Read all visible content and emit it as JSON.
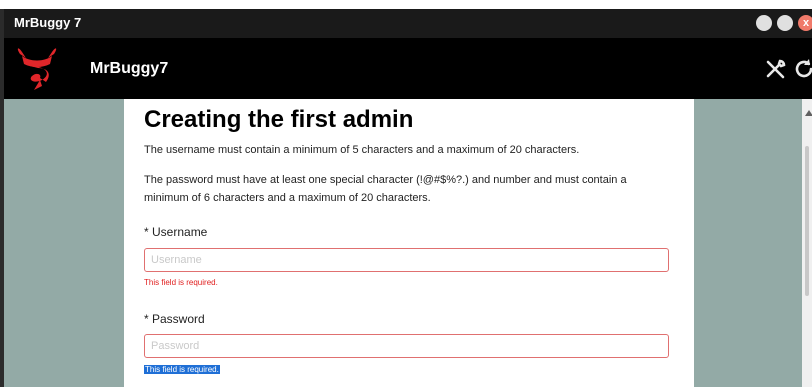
{
  "window": {
    "title": "MrBuggy 7",
    "close_glyph": "x"
  },
  "app": {
    "name": "MrBuggy7",
    "icons": [
      "devil-logo-icon",
      "tools-icon",
      "refresh-icon"
    ]
  },
  "form": {
    "heading": "Creating the first admin",
    "username_rule": "The username must contain a minimum of 5 characters and a maximum of 20 characters.",
    "password_rule": "The password must have at least one special character (!@#$%?.) and number and must contain a minimum of 6 characters and a maximum of 20 characters.",
    "username": {
      "label": "* Username",
      "placeholder": "Username",
      "value": "",
      "error": "This field is required."
    },
    "password": {
      "label": "* Password",
      "placeholder": "Password",
      "value": "",
      "error": "This field is required."
    }
  },
  "colors": {
    "accent_error": "#e02020",
    "content_bg": "#93aaa6",
    "selection": "#1f6fd6",
    "logo_red": "#e0262a"
  }
}
